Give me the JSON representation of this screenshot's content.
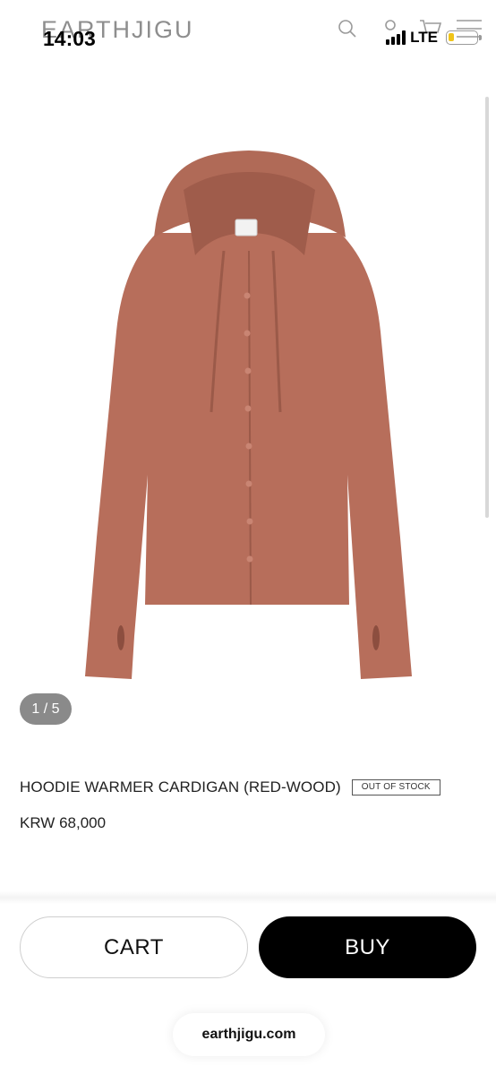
{
  "header": {
    "brand": "EARTHJIGU",
    "icons": [
      "search-icon",
      "account-icon",
      "cart-icon",
      "menu-icon"
    ]
  },
  "status_bar": {
    "time": "14:03",
    "network": "LTE"
  },
  "gallery": {
    "counter": "1 / 5"
  },
  "product": {
    "name": "HOODIE WARMER CARDIGAN (RED-WOOD)",
    "stock_badge": "OUT OF STOCK",
    "price": "KRW 68,000",
    "color": "#b76e5b"
  },
  "actions": {
    "cart_label": "CART",
    "buy_label": "BUY"
  },
  "browser": {
    "url": "earthjigu.com"
  }
}
